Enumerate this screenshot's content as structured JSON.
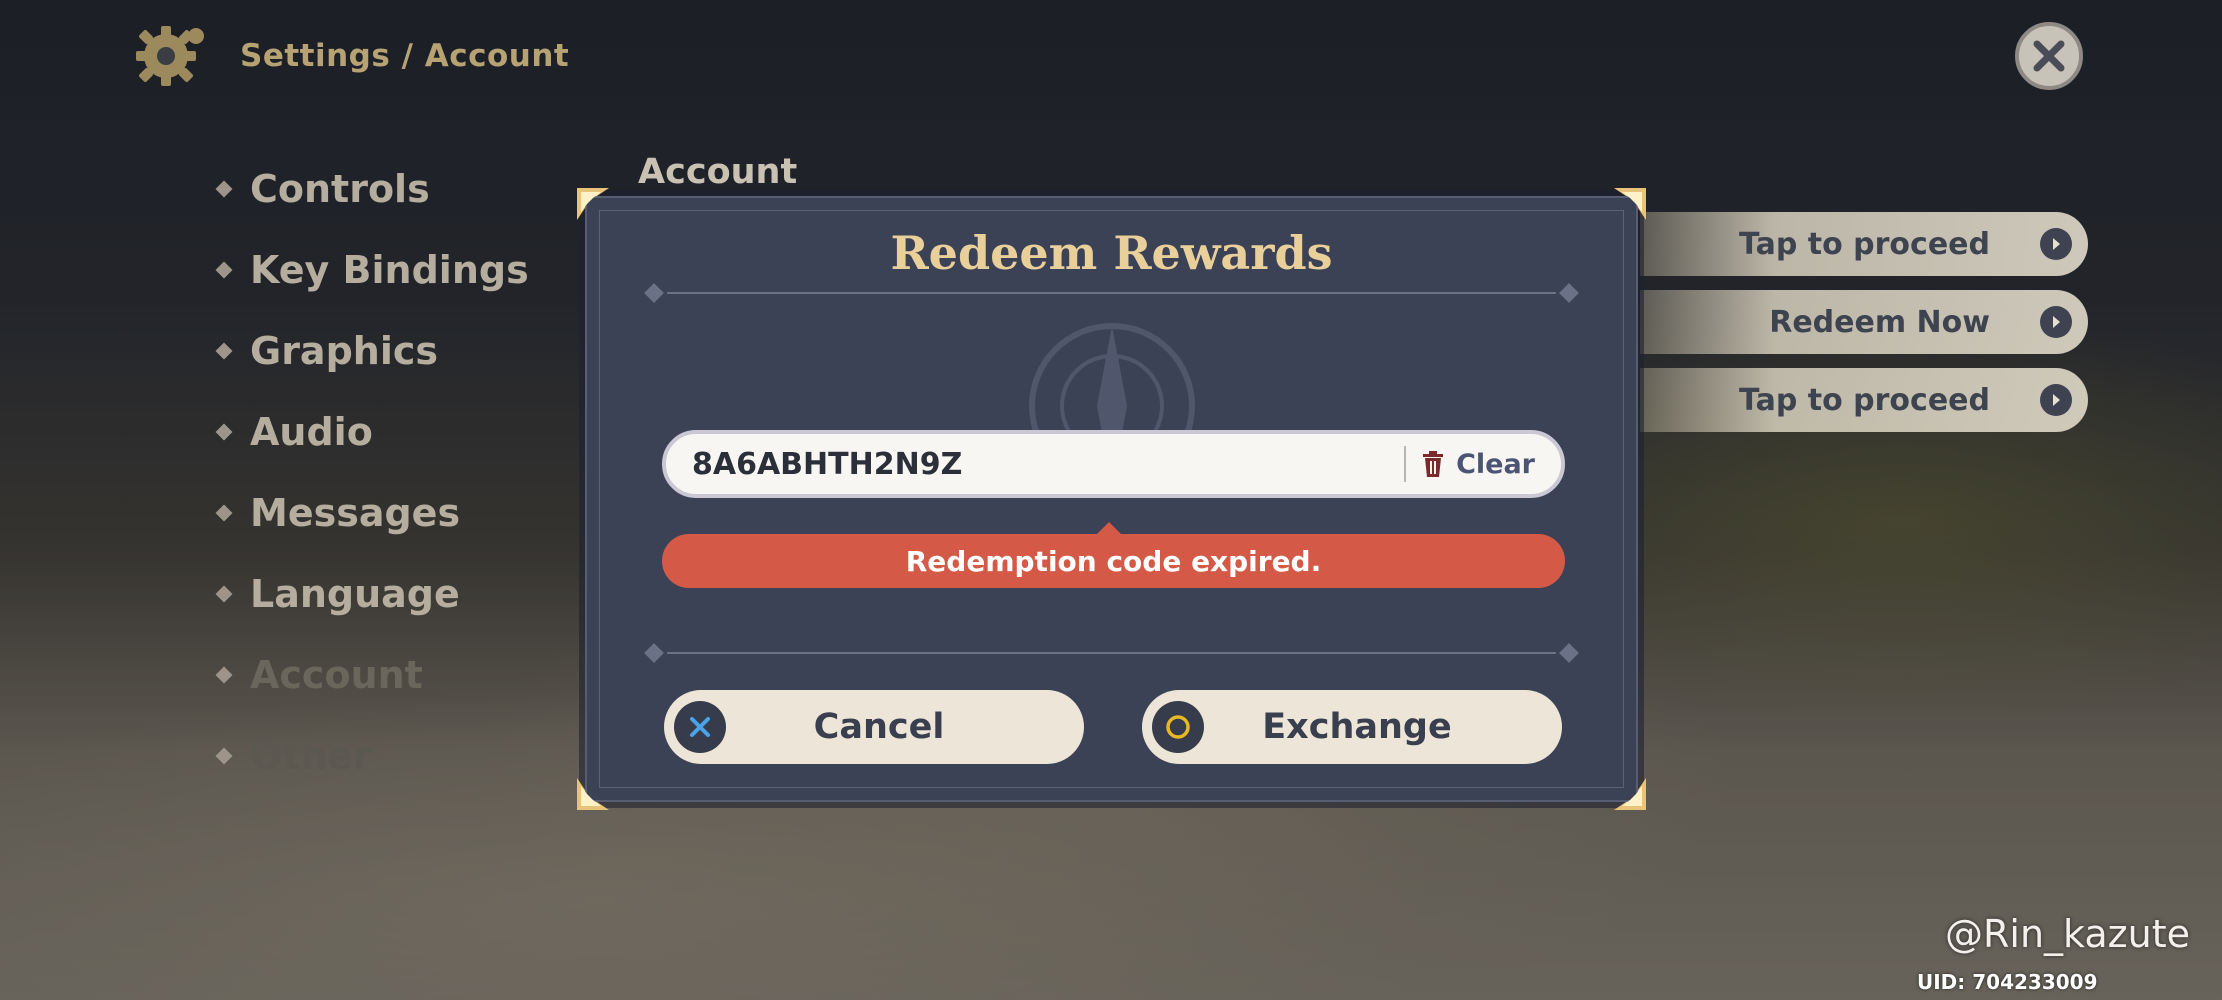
{
  "header": {
    "breadcrumb": "Settings / Account"
  },
  "sidebar": {
    "items": [
      {
        "label": "Controls"
      },
      {
        "label": "Key Bindings"
      },
      {
        "label": "Graphics"
      },
      {
        "label": "Audio"
      },
      {
        "label": "Messages"
      },
      {
        "label": "Language"
      },
      {
        "label": "Account"
      },
      {
        "label": "Other"
      }
    ]
  },
  "main": {
    "heading": "Account",
    "actions": [
      {
        "label": "Tap to proceed"
      },
      {
        "label": "Redeem Now"
      },
      {
        "label": "Tap to proceed"
      }
    ]
  },
  "modal": {
    "title": "Redeem Rewards",
    "code_value": "8A6ABHTH2N9Z",
    "clear_label": "Clear",
    "error_text": "Redemption code expired.",
    "cancel_label": "Cancel",
    "exchange_label": "Exchange"
  },
  "footer": {
    "watermark": "@Rin_kazute",
    "uid": "UID: 704233009"
  },
  "colors": {
    "title_gold": "#e9cf9a",
    "modal_bg": "#3c4256",
    "error_red": "#d45a47",
    "cancel_icon_blue": "#4aa3e8",
    "exchange_icon_gold": "#e8b923"
  }
}
